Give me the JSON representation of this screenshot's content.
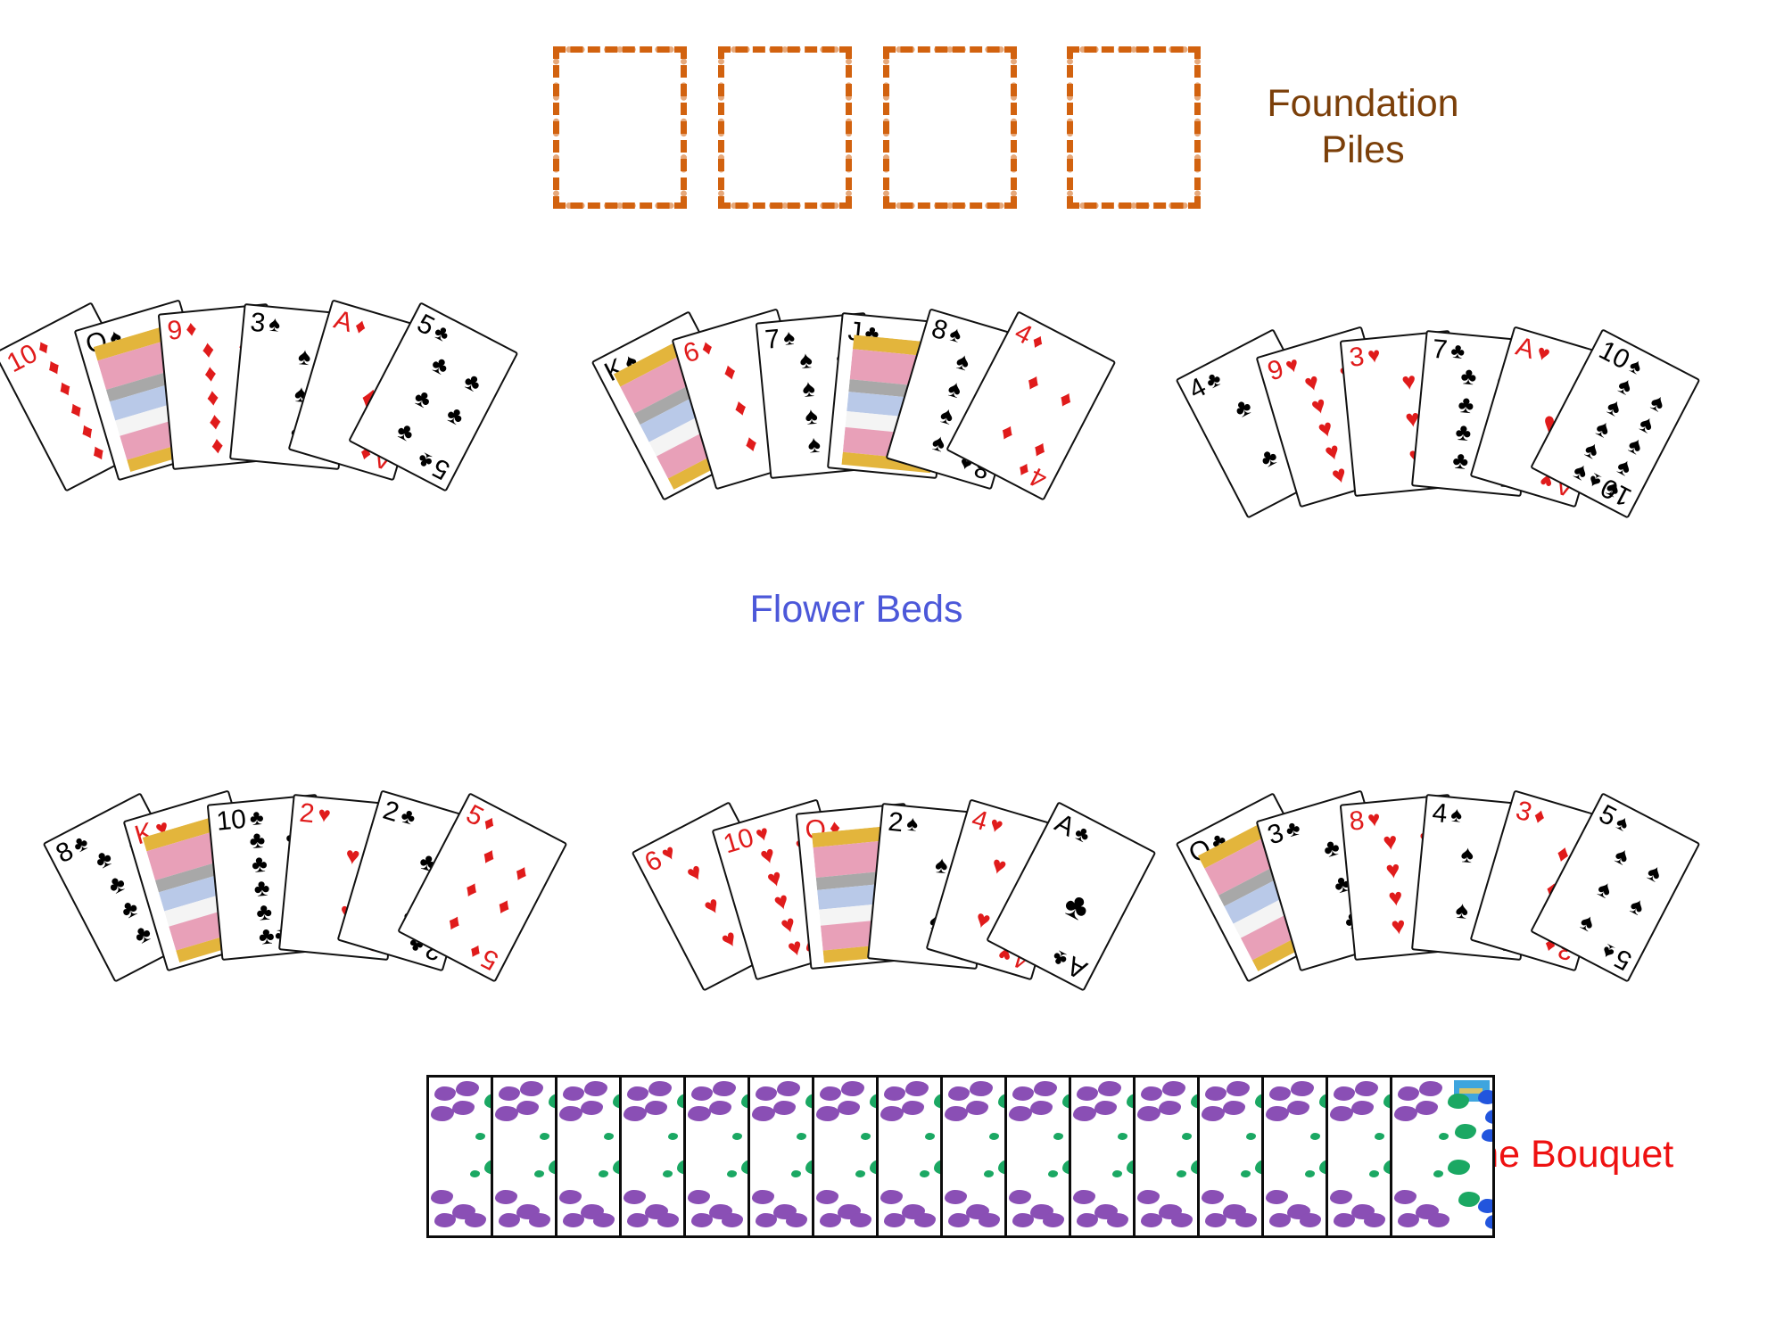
{
  "labels": {
    "foundation": "Foundation\nPiles",
    "flower_beds": "Flower Beds",
    "bouquet": "The Bouquet"
  },
  "colors": {
    "foundation_label": "#7B3F09",
    "foundation_border": "#D2620F",
    "flower_beds_label": "#4C58D9",
    "bouquet_label": "#EE1111",
    "card_red": "#E01B1B",
    "card_black": "#000000",
    "back_purple": "#8A4FB5",
    "back_green": "#1BA863",
    "back_blue": "#2255DD",
    "back_tab": "#3EA5DE"
  },
  "foundation_piles": [
    {
      "index": 1,
      "card": ""
    },
    {
      "index": 2,
      "card": ""
    },
    {
      "index": 3,
      "card": ""
    },
    {
      "index": 4,
      "card": ""
    }
  ],
  "flower_beds": [
    {
      "id": "flower-bed-1",
      "row": 1,
      "cards": [
        {
          "rank": "10",
          "suit": "♦",
          "color": "red",
          "face": false
        },
        {
          "rank": "Q",
          "suit": "♠",
          "color": "black",
          "face": true
        },
        {
          "rank": "9",
          "suit": "♦",
          "color": "red",
          "face": false
        },
        {
          "rank": "3",
          "suit": "♠",
          "color": "black",
          "face": false
        },
        {
          "rank": "A",
          "suit": "♦",
          "color": "red",
          "face": false
        },
        {
          "rank": "5",
          "suit": "♣",
          "color": "black",
          "face": false
        }
      ]
    },
    {
      "id": "flower-bed-2",
      "row": 1,
      "cards": [
        {
          "rank": "K",
          "suit": "♠",
          "color": "black",
          "face": true
        },
        {
          "rank": "6",
          "suit": "♦",
          "color": "red",
          "face": false
        },
        {
          "rank": "7",
          "suit": "♠",
          "color": "black",
          "face": false
        },
        {
          "rank": "J",
          "suit": "♣",
          "color": "black",
          "face": true
        },
        {
          "rank": "8",
          "suit": "♠",
          "color": "black",
          "face": false
        },
        {
          "rank": "4",
          "suit": "♦",
          "color": "red",
          "face": false
        }
      ]
    },
    {
      "id": "flower-bed-3",
      "row": 1,
      "cards": [
        {
          "rank": "4",
          "suit": "♣",
          "color": "black",
          "face": false
        },
        {
          "rank": "9",
          "suit": "♥",
          "color": "red",
          "face": false
        },
        {
          "rank": "3",
          "suit": "♥",
          "color": "red",
          "face": false
        },
        {
          "rank": "7",
          "suit": "♣",
          "color": "black",
          "face": false
        },
        {
          "rank": "A",
          "suit": "♥",
          "color": "red",
          "face": false
        },
        {
          "rank": "10",
          "suit": "♠",
          "color": "black",
          "face": false
        }
      ]
    },
    {
      "id": "flower-bed-4",
      "row": 2,
      "cards": [
        {
          "rank": "8",
          "suit": "♣",
          "color": "black",
          "face": false
        },
        {
          "rank": "K",
          "suit": "♥",
          "color": "red",
          "face": true
        },
        {
          "rank": "10",
          "suit": "♣",
          "color": "black",
          "face": false
        },
        {
          "rank": "2",
          "suit": "♥",
          "color": "red",
          "face": false
        },
        {
          "rank": "2",
          "suit": "♣",
          "color": "black",
          "face": false
        },
        {
          "rank": "5",
          "suit": "♦",
          "color": "red",
          "face": false
        }
      ]
    },
    {
      "id": "flower-bed-5",
      "row": 2,
      "cards": [
        {
          "rank": "6",
          "suit": "♥",
          "color": "red",
          "face": false
        },
        {
          "rank": "10",
          "suit": "♥",
          "color": "red",
          "face": false
        },
        {
          "rank": "Q",
          "suit": "♦",
          "color": "red",
          "face": true
        },
        {
          "rank": "2",
          "suit": "♠",
          "color": "black",
          "face": false
        },
        {
          "rank": "4",
          "suit": "♥",
          "color": "red",
          "face": false
        },
        {
          "rank": "A",
          "suit": "♣",
          "color": "black",
          "face": false
        }
      ]
    },
    {
      "id": "flower-bed-6",
      "row": 2,
      "cards": [
        {
          "rank": "Q",
          "suit": "♣",
          "color": "black",
          "face": true
        },
        {
          "rank": "3",
          "suit": "♣",
          "color": "black",
          "face": false
        },
        {
          "rank": "8",
          "suit": "♥",
          "color": "red",
          "face": false
        },
        {
          "rank": "4",
          "suit": "♠",
          "color": "black",
          "face": false
        },
        {
          "rank": "3",
          "suit": "♦",
          "color": "red",
          "face": false
        },
        {
          "rank": "5",
          "suit": "♠",
          "color": "black",
          "face": false
        }
      ]
    }
  ],
  "bouquet": {
    "count": 16,
    "face_down": true
  }
}
